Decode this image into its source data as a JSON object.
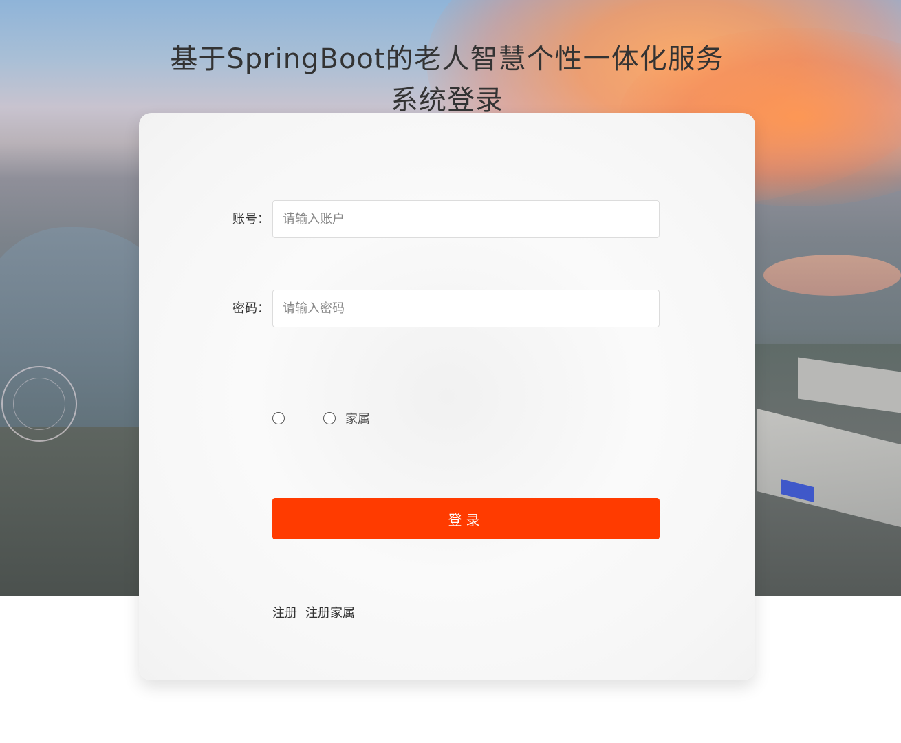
{
  "page": {
    "title_line1": "基于SpringBoot的老人智慧个性一体化服务",
    "title_line2": "系统登录"
  },
  "form": {
    "account_label": "账号：",
    "account_placeholder": "请输入账户",
    "account_value": "",
    "password_label": "密码：",
    "password_placeholder": "请输入密码",
    "password_value": "",
    "roles": [
      {
        "label": "",
        "selected": false
      },
      {
        "label": "家属",
        "selected": false
      }
    ],
    "login_label": "登录"
  },
  "links": {
    "register": "注册",
    "register_family": "注册家属"
  },
  "colors": {
    "login_button": "#ff3b00",
    "title_text": "#333333",
    "card_bg": "#f7f7f7"
  }
}
